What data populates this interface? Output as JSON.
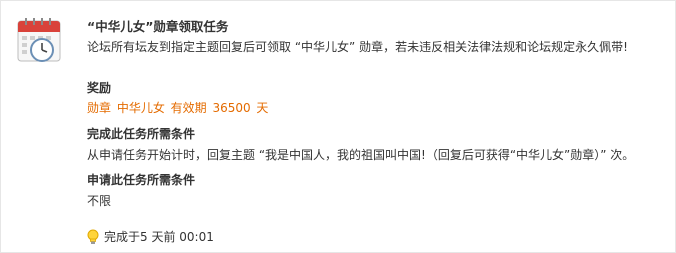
{
  "task": {
    "title": "“中华儿女”勋章领取任务",
    "description": "论坛所有坛友到指定主题回复后可领取 “中华儿女” 勋章，若未违反相关法律法规和论坛规定永久佩带!"
  },
  "reward": {
    "heading": "奖励",
    "text": "勋章 中华儿女 有效期 36500 天"
  },
  "requirements": {
    "heading": "完成此任务所需条件",
    "text": "从申请任务开始计时，回复主题 “我是中国人，我的祖国叫中国!（回复后可获得“中华儿女”勋章）” 次。"
  },
  "apply_conditions": {
    "heading": "申请此任务所需条件",
    "text": "不限"
  },
  "status": {
    "icon": "lightbulb-icon",
    "text": "完成于5 天前 00:01"
  },
  "colors": {
    "reward": "#e46b00",
    "text": "#333333",
    "calendar_red": "#d9423a"
  }
}
